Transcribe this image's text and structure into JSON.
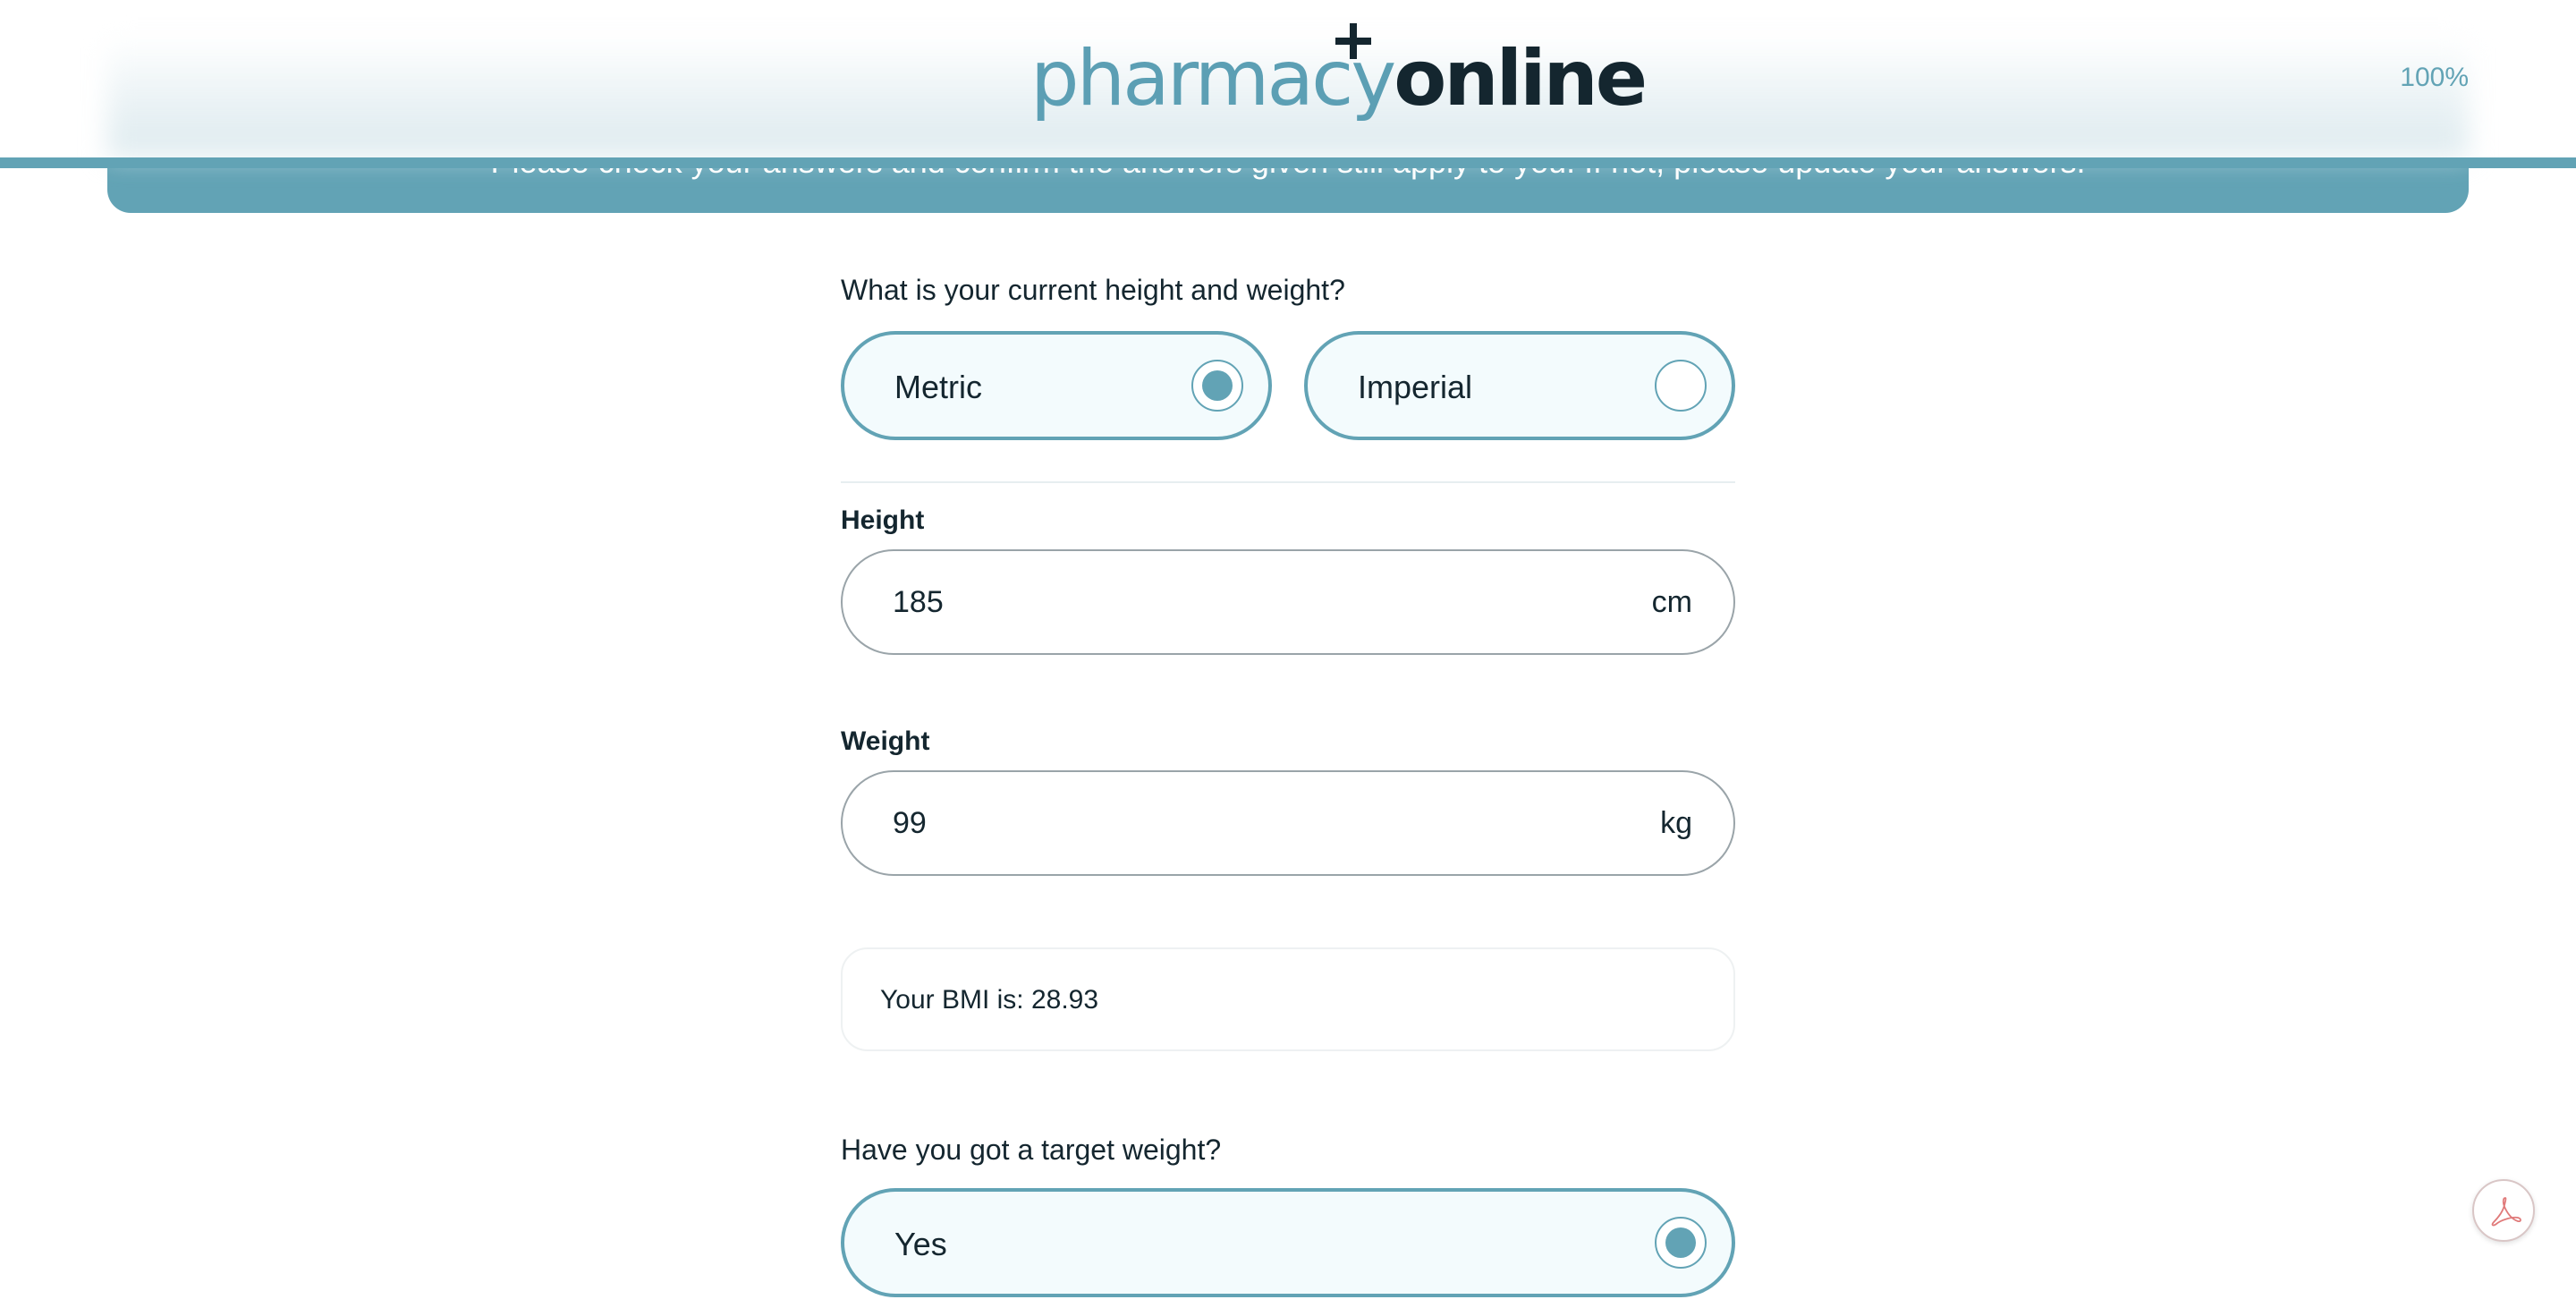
{
  "header": {
    "logo_part1": "pharmacy",
    "logo_part2": "online",
    "progress": "100%"
  },
  "banner": {
    "text": "Please check your answers and confirm the answers given still apply to you. If not, please update your answers."
  },
  "height_weight": {
    "question": "What is your current height and weight?",
    "options": [
      {
        "label": "Metric",
        "selected": true
      },
      {
        "label": "Imperial",
        "selected": false
      }
    ],
    "height": {
      "label": "Height",
      "value": "185",
      "unit": "cm"
    },
    "weight": {
      "label": "Weight",
      "value": "99",
      "unit": "kg"
    },
    "bmi_text": "Your BMI is: 28.93"
  },
  "target_weight": {
    "question": "Have you got a target weight?",
    "options": [
      {
        "label": "Yes",
        "selected": true
      }
    ]
  },
  "pdf_button": {
    "icon": "pdf-icon"
  },
  "colors": {
    "accent": "#62a3b5",
    "dark_text": "#14262f",
    "option_bg": "#f3fbfd"
  }
}
